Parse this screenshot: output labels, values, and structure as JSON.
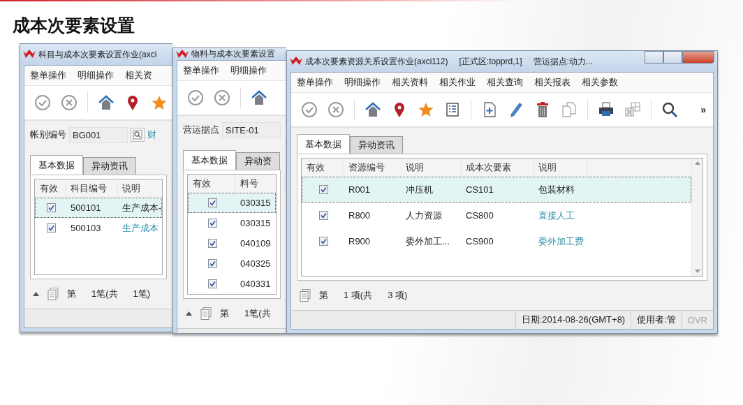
{
  "slide_title": "成本次要素设置",
  "windows": [
    {
      "title_parts": [
        "科目与成本次要素设置作业(axci"
      ],
      "window_controls": false,
      "menus": [
        "整单操作",
        "明细操作",
        "相关资"
      ],
      "toolbar": [
        {
          "kind": "confirm"
        },
        {
          "kind": "cancel"
        },
        {
          "kind": "separator"
        },
        {
          "kind": "home"
        },
        {
          "kind": "pin"
        },
        {
          "kind": "star"
        }
      ],
      "field": {
        "label": "帐别编号",
        "value": "BG001",
        "lookup": true,
        "link": "财"
      },
      "tabs": [
        {
          "label": "基本数据",
          "selected": true
        },
        {
          "label": "异动资讯",
          "selected": false
        }
      ],
      "columns": [
        "有效",
        "科目编号",
        "说明"
      ],
      "rows": [
        {
          "selected": true,
          "cells": [
            {
              "kind": "checkbox",
              "checked": true
            },
            {
              "kind": "text",
              "text": "500101",
              "link": false
            },
            {
              "kind": "text",
              "text": "生产成本-",
              "link": false
            }
          ]
        },
        {
          "selected": false,
          "cells": [
            {
              "kind": "checkbox",
              "checked": true
            },
            {
              "kind": "text",
              "text": "500103",
              "link": false
            },
            {
              "kind": "text",
              "text": "生产成本",
              "link": true
            }
          ]
        }
      ],
      "scrollbar": false,
      "pager": {
        "caret": true,
        "texts": [
          "第",
          "1笔(共",
          "1笔)"
        ]
      }
    },
    {
      "title_parts": [
        "物料与成本次要素设置"
      ],
      "window_controls": false,
      "menus": [
        "整单操作",
        "明细操作"
      ],
      "toolbar": [
        {
          "kind": "confirm"
        },
        {
          "kind": "cancel"
        },
        {
          "kind": "separator"
        },
        {
          "kind": "home"
        }
      ],
      "field": {
        "label": "营运据点",
        "value": "SITE-01",
        "lookup": false
      },
      "tabs": [
        {
          "label": "基本数据",
          "selected": true
        },
        {
          "label": "异动资",
          "selected": false
        }
      ],
      "columns": [
        "有效",
        "料号"
      ],
      "rows": [
        {
          "selected": true,
          "cells": [
            {
              "kind": "checkbox",
              "checked": true
            },
            {
              "kind": "text",
              "text": "030315",
              "link": false
            }
          ]
        },
        {
          "selected": false,
          "cells": [
            {
              "kind": "checkbox",
              "checked": true
            },
            {
              "kind": "text",
              "text": "030315",
              "link": false
            }
          ]
        },
        {
          "selected": false,
          "cells": [
            {
              "kind": "checkbox",
              "checked": true
            },
            {
              "kind": "text",
              "text": "040109",
              "link": false
            }
          ]
        },
        {
          "selected": false,
          "cells": [
            {
              "kind": "checkbox",
              "checked": true
            },
            {
              "kind": "text",
              "text": "040325",
              "link": false
            }
          ]
        },
        {
          "selected": false,
          "cells": [
            {
              "kind": "checkbox",
              "checked": true
            },
            {
              "kind": "text",
              "text": "040331",
              "link": false
            }
          ]
        }
      ],
      "scrollbar": false,
      "pager": {
        "caret": true,
        "texts": [
          "第",
          "1笔(共"
        ]
      }
    },
    {
      "title_parts": [
        "成本次要素资源关系设置作业(axci112)",
        "[正式区:topprd,1]",
        "营运据点:动力..."
      ],
      "window_controls": true,
      "menus": [
        "整单操作",
        "明细操作",
        "相关资料",
        "相关作业",
        "相关查询",
        "相关报表",
        "相关参数"
      ],
      "toolbar": [
        {
          "kind": "confirm"
        },
        {
          "kind": "cancel"
        },
        {
          "kind": "separator"
        },
        {
          "kind": "home"
        },
        {
          "kind": "pin"
        },
        {
          "kind": "star"
        },
        {
          "kind": "list"
        },
        {
          "kind": "separator"
        },
        {
          "kind": "new"
        },
        {
          "kind": "edit"
        },
        {
          "kind": "delete"
        },
        {
          "kind": "copy"
        },
        {
          "kind": "separator"
        },
        {
          "kind": "print"
        },
        {
          "kind": "export"
        },
        {
          "kind": "separator"
        },
        {
          "kind": "search"
        }
      ],
      "toolbar_more": "»",
      "tabs": [
        {
          "label": "基本数据",
          "selected": true
        },
        {
          "label": "异动资讯",
          "selected": false
        }
      ],
      "columns": [
        "有效",
        "资源编号",
        "说明",
        "成本次要素",
        "说明"
      ],
      "rows": [
        {
          "selected": true,
          "cells": [
            {
              "kind": "checkbox",
              "checked": true
            },
            {
              "kind": "text",
              "text": "R001",
              "link": false
            },
            {
              "kind": "text",
              "text": "冲压机",
              "link": false
            },
            {
              "kind": "text",
              "text": "CS101",
              "link": false
            },
            {
              "kind": "text",
              "text": "包装材料",
              "link": false
            }
          ]
        },
        {
          "selected": false,
          "cells": [
            {
              "kind": "checkbox",
              "checked": true
            },
            {
              "kind": "text",
              "text": "R800",
              "link": false
            },
            {
              "kind": "text",
              "text": "人力资源",
              "link": false
            },
            {
              "kind": "text",
              "text": "CS800",
              "link": false
            },
            {
              "kind": "text",
              "text": "直接人工",
              "link": true
            }
          ]
        },
        {
          "selected": false,
          "cells": [
            {
              "kind": "checkbox",
              "checked": true
            },
            {
              "kind": "text",
              "text": "R900",
              "link": false
            },
            {
              "kind": "text",
              "text": "委外加工...",
              "link": false
            },
            {
              "kind": "text",
              "text": "CS900",
              "link": false
            },
            {
              "kind": "text",
              "text": "委外加工费",
              "link": true
            }
          ]
        }
      ],
      "scrollbar": true,
      "pager": {
        "caret": false,
        "texts": [
          "第",
          "1 项(共",
          "3 项)"
        ]
      },
      "status_bar": [
        {
          "text": "日期:2014-08-26(GMT+8)",
          "disabled": false
        },
        {
          "text": "使用者:管",
          "disabled": false
        },
        {
          "text": "OVR",
          "disabled": true
        }
      ]
    }
  ]
}
